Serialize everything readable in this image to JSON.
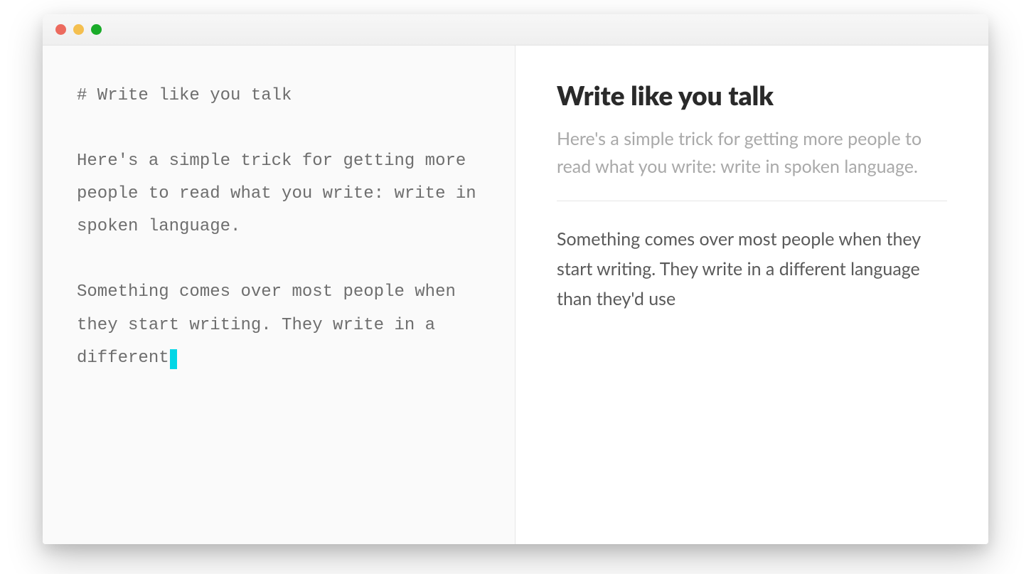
{
  "window": {
    "traffic_lights": {
      "red": "#ec6a5e",
      "yellow": "#f4bf4f",
      "green": "#1aab29"
    }
  },
  "editor": {
    "raw_text": "# Write like you talk\n\nHere's a simple trick for getting more people to read what you write: write in spoken language.\n\nSomething comes over most people when they start writing. They write in a different",
    "cursor_color": "#00d6e6"
  },
  "preview": {
    "title": "Write like you talk",
    "intro": "Here's a simple trick for getting more people to read what you write: write in spoken language.",
    "body": "Something comes over most people when they start writing. They write in a different language than they'd use"
  }
}
